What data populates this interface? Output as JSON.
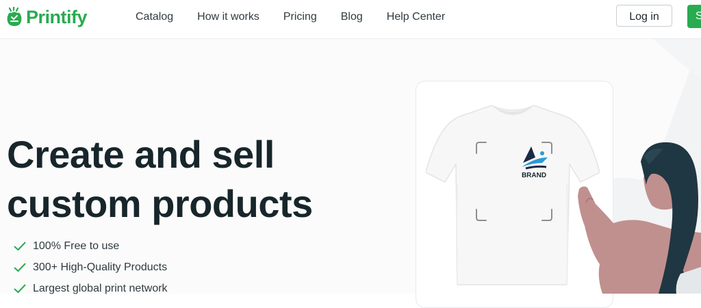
{
  "header": {
    "brand": "Printify",
    "nav": [
      {
        "label": "Catalog"
      },
      {
        "label": "How it works"
      },
      {
        "label": "Pricing"
      },
      {
        "label": "Blog"
      },
      {
        "label": "Help Center"
      }
    ],
    "login_label": "Log in",
    "signup_label": "S"
  },
  "hero": {
    "headline_line1": "Create and sell",
    "headline_line2": "custom products",
    "features": [
      {
        "label": "100% Free to use"
      },
      {
        "label": "300+ High-Quality Products"
      },
      {
        "label": "Largest global print network"
      }
    ],
    "product": {
      "brand_label": "BRAND"
    }
  },
  "colors": {
    "brand_green": "#29ab51",
    "headline": "#17262b",
    "check": "#29ab51"
  },
  "icons": {
    "logo": "printify-logo-icon",
    "check": "check-icon"
  }
}
